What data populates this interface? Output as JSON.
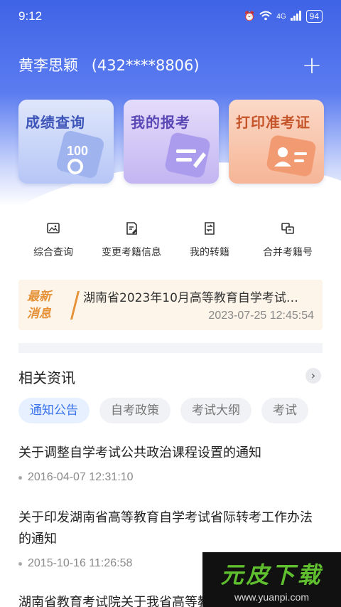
{
  "status": {
    "time": "9:12",
    "network": "4G",
    "battery": "94"
  },
  "account": {
    "name": "黄李思颖",
    "id_masked": "(432****8806)"
  },
  "cards": [
    {
      "label": "成绩查询",
      "icon": "score-100-icon"
    },
    {
      "label": "我的报考",
      "icon": "enroll-edit-icon"
    },
    {
      "label": "打印准考证",
      "icon": "admission-card-icon"
    }
  ],
  "quick_actions": [
    {
      "label": "综合查询",
      "icon": "image-icon"
    },
    {
      "label": "变更考籍信息",
      "icon": "edit-doc-icon"
    },
    {
      "label": "我的转籍",
      "icon": "transfer-doc-icon"
    },
    {
      "label": "合并考籍号",
      "icon": "merge-icon"
    }
  ],
  "notice": {
    "tag_line1": "最新",
    "tag_line2": "消息",
    "title": "湖南省2023年10月高等教育自学考试…",
    "date": "2023-07-25 12:45:54"
  },
  "news_section": {
    "title": "相关资讯",
    "more_icon": "chevron-right-icon",
    "tabs": [
      "通知公告",
      "自考政策",
      "考试大纲",
      "考试"
    ],
    "items": [
      {
        "title": "关于调整自学考试公共政治课程设置的通知",
        "date": "2016-04-07 12:31:10"
      },
      {
        "title": "关于印发湖南省高等教育自学考试省际转考工作办法的通知",
        "date": "2015-10-16 11:26:58"
      },
      {
        "title": "湖南省教育考试院关于我省高等教育自学考试"
      }
    ]
  },
  "watermark": {
    "text": "元皮下载",
    "url": "www.yuanpi.com"
  },
  "colors": {
    "primary": "#3f63e6",
    "accent_orange": "#e59238",
    "tab_active": "#3a72ee"
  }
}
